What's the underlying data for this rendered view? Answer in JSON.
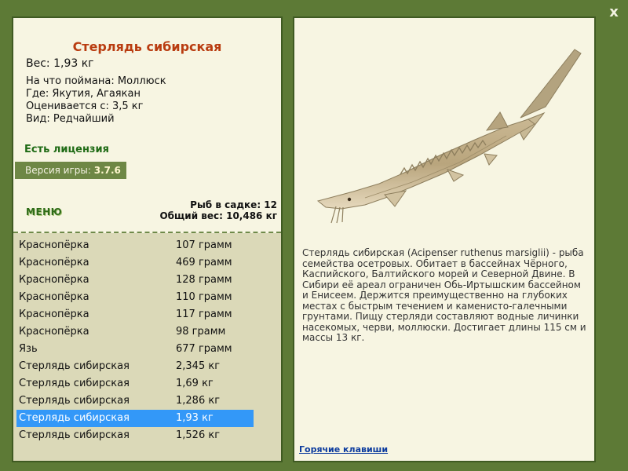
{
  "close_label": "x",
  "fish": {
    "title": "Стерлядь сибирская",
    "weight": "Вес: 1,93 кг",
    "info": [
      "На что поймана: Моллюск",
      "Где: Якутия, Агаякан",
      "Оценивается с: 3,5 кг",
      "Вид: Редчайший"
    ],
    "license": "Есть лицензия",
    "description": "Стерлядь сибирская (Acipenser ruthenus marsiglii) - рыба семейства осетровых. Обитает в бассейнах Чёрного, Каспийского, Балтийского морей и Северной Двине. В Сибири её ареал ограничен Обь-Иртышским бассейном и Енисеем. Держится преимущественно на глубоких местах с быстрым течением и каменисто-галечными грунтами. Пищу стерляди составляют водные личинки насекомых, черви, моллюски. Достигает длины 115 см и массы 13 кг."
  },
  "version": {
    "label": "Версия игры:",
    "number": "3.7.6"
  },
  "menu_label": "МЕНЮ",
  "stats": {
    "fish_count": "Рыб в садке: 12",
    "total_weight": "Общий вес: 10,486 кг"
  },
  "catch_list": [
    {
      "name": "Краснопёрка",
      "weight": "107 грамм",
      "selected": false
    },
    {
      "name": "Краснопёрка",
      "weight": "469 грамм",
      "selected": false
    },
    {
      "name": "Краснопёрка",
      "weight": "128 грамм",
      "selected": false
    },
    {
      "name": "Краснопёрка",
      "weight": "110 грамм",
      "selected": false
    },
    {
      "name": "Краснопёрка",
      "weight": "117 грамм",
      "selected": false
    },
    {
      "name": "Краснопёрка",
      "weight": "98 грамм",
      "selected": false
    },
    {
      "name": "Язь",
      "weight": "677 грамм",
      "selected": false
    },
    {
      "name": "Стерлядь сибирская",
      "weight": "2,345 кг",
      "selected": false
    },
    {
      "name": "Стерлядь сибирская",
      "weight": "1,69 кг",
      "selected": false
    },
    {
      "name": "Стерлядь сибирская",
      "weight": "1,286 кг",
      "selected": false
    },
    {
      "name": "Стерлядь сибирская",
      "weight": "1,93 кг",
      "selected": true
    },
    {
      "name": "Стерлядь сибирская",
      "weight": "1,526 кг",
      "selected": false
    }
  ],
  "hotkeys_label": "Горячие клавиши",
  "colors": {
    "frame": "#5d7a36",
    "panel": "#f7f5e2",
    "title": "#b93c10",
    "license": "#1f6b15",
    "selection": "#3398f8"
  }
}
